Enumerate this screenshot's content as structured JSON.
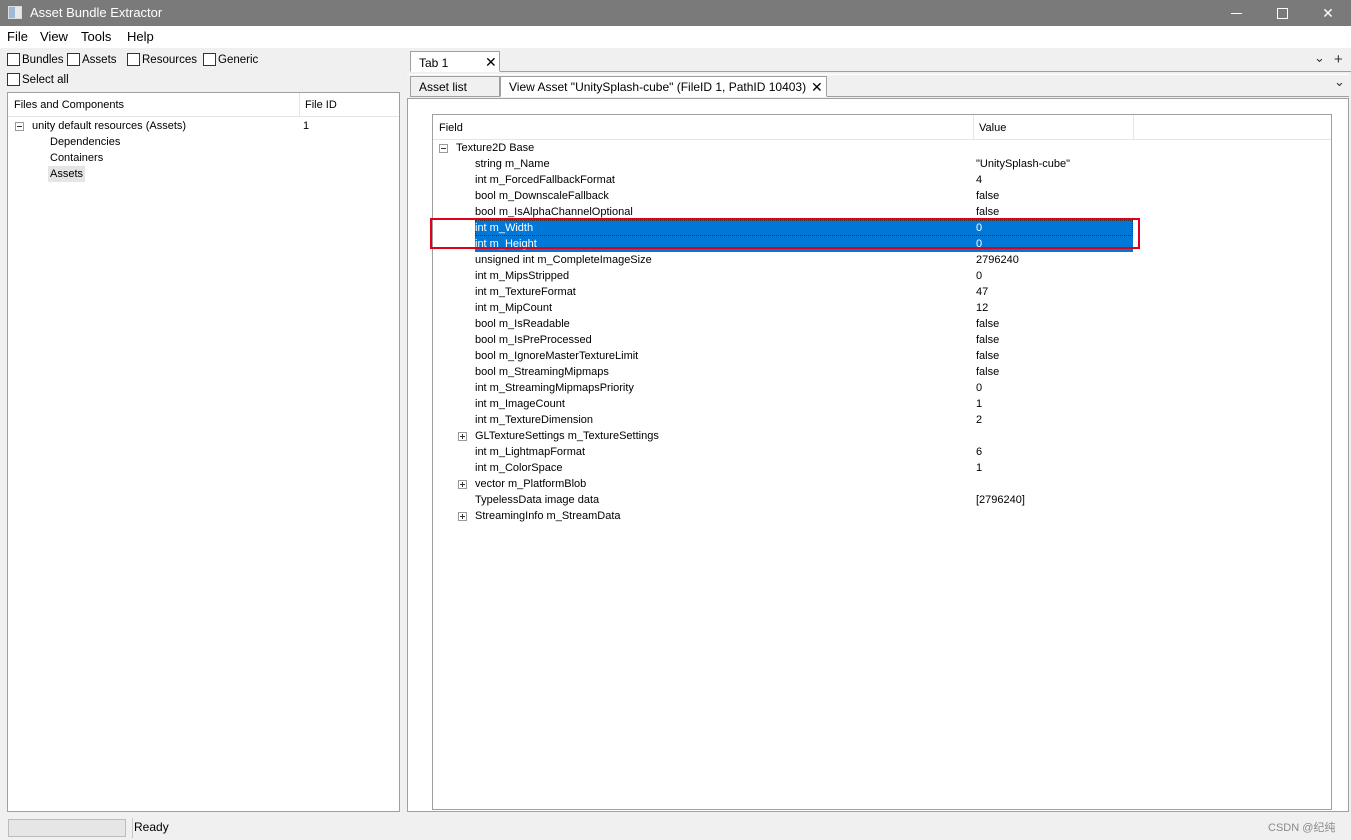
{
  "window": {
    "title": "Asset Bundle Extractor",
    "minimize_glyph": "—",
    "maximize_glyph": "☐",
    "close_glyph": "✕"
  },
  "menu": [
    "File",
    "View",
    "Tools",
    "Help"
  ],
  "filters": [
    {
      "label": "Bundles",
      "checked": false
    },
    {
      "label": "Assets",
      "checked": false
    },
    {
      "label": "Resources",
      "checked": false
    },
    {
      "label": "Generic",
      "checked": false
    },
    {
      "label": "Select all",
      "checked": false
    }
  ],
  "left_tree": {
    "headers": [
      "Files and Components",
      "File ID"
    ],
    "root": {
      "label": "unity default resources (Assets)",
      "file_id": "1"
    },
    "children": [
      "Dependencies",
      "Containers",
      "Assets"
    ]
  },
  "tabs": {
    "outer": [
      {
        "label": "Tab 1"
      }
    ],
    "inner": [
      {
        "label": "Asset list"
      },
      {
        "label": "View Asset \"UnitySplash-cube\" (FileID 1, PathID 10403)"
      }
    ],
    "close_glyph": "✕",
    "dropdown_glyph": "⌄",
    "add_glyph": "+"
  },
  "field_tree": {
    "headers": [
      "Field",
      "Value"
    ],
    "root": "Texture2D Base",
    "rows": [
      {
        "field": "string m_Name",
        "value": "\"UnitySplash-cube\"",
        "expand": false
      },
      {
        "field": "int m_ForcedFallbackFormat",
        "value": "4",
        "expand": false
      },
      {
        "field": "bool m_DownscaleFallback",
        "value": "false",
        "expand": false
      },
      {
        "field": "bool m_IsAlphaChannelOptional",
        "value": "false",
        "expand": false
      },
      {
        "field": "int m_Width",
        "value": "0",
        "expand": false,
        "selected": true
      },
      {
        "field": "int m_Height",
        "value": "0",
        "expand": false,
        "selected": true
      },
      {
        "field": "unsigned int m_CompleteImageSize",
        "value": "2796240",
        "expand": false
      },
      {
        "field": "int m_MipsStripped",
        "value": "0",
        "expand": false
      },
      {
        "field": "int m_TextureFormat",
        "value": "47",
        "expand": false
      },
      {
        "field": "int m_MipCount",
        "value": "12",
        "expand": false
      },
      {
        "field": "bool m_IsReadable",
        "value": "false",
        "expand": false
      },
      {
        "field": "bool m_IsPreProcessed",
        "value": "false",
        "expand": false
      },
      {
        "field": "bool m_IgnoreMasterTextureLimit",
        "value": "false",
        "expand": false
      },
      {
        "field": "bool m_StreamingMipmaps",
        "value": "false",
        "expand": false
      },
      {
        "field": "int m_StreamingMipmapsPriority",
        "value": "0",
        "expand": false
      },
      {
        "field": "int m_ImageCount",
        "value": "1",
        "expand": false
      },
      {
        "field": "int m_TextureDimension",
        "value": "2",
        "expand": false
      },
      {
        "field": "GLTextureSettings m_TextureSettings",
        "value": "",
        "expand": true
      },
      {
        "field": "int m_LightmapFormat",
        "value": "6",
        "expand": false
      },
      {
        "field": "int m_ColorSpace",
        "value": "1",
        "expand": false
      },
      {
        "field": "vector m_PlatformBlob",
        "value": "",
        "expand": true
      },
      {
        "field": "TypelessData image data",
        "value": "[2796240]",
        "expand": false
      },
      {
        "field": "StreamingInfo m_StreamData",
        "value": "",
        "expand": true
      }
    ]
  },
  "status": {
    "text": "Ready",
    "watermark": "CSDN @纪纯"
  },
  "colors": {
    "selection": "#0078d7",
    "highlight_box": "#e0001a",
    "titlebar": "#7a7a7a"
  }
}
